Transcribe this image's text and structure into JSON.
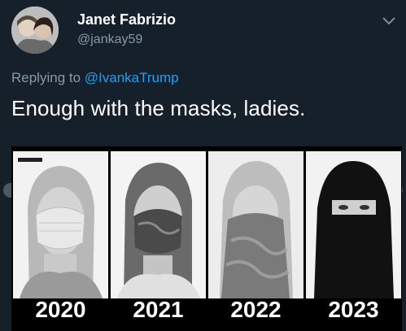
{
  "user": {
    "name": "Janet Fabrizio",
    "handle": "@jankay59"
  },
  "reply": {
    "prefix": "Replying to ",
    "mention": "@IvankaTrump"
  },
  "tweet": {
    "text": "Enough with the masks, ladies."
  },
  "media": {
    "years": [
      "2020",
      "2021",
      "2022",
      "2023"
    ]
  }
}
